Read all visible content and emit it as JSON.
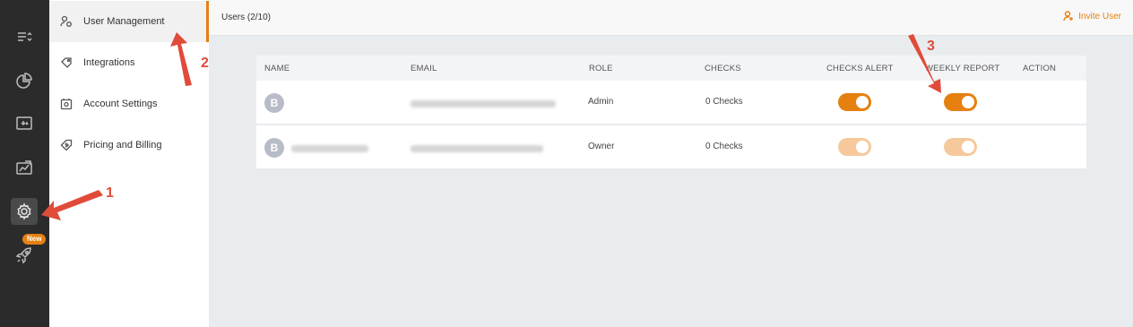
{
  "rail": {
    "items": [
      {
        "icon": "filter-list-icon"
      },
      {
        "icon": "pie-chart-icon"
      },
      {
        "icon": "monitor-icon"
      },
      {
        "icon": "analytics-icon"
      },
      {
        "icon": "gear-icon",
        "active": true
      },
      {
        "icon": "rocket-icon"
      }
    ],
    "new_badge": "New"
  },
  "subnav": {
    "items": [
      {
        "label": "User Management",
        "icon": "user-management-icon",
        "active": true
      },
      {
        "label": "Integrations",
        "icon": "integrations-icon"
      },
      {
        "label": "Account Settings",
        "icon": "account-settings-icon"
      },
      {
        "label": "Pricing and Billing",
        "icon": "pricing-billing-icon"
      }
    ]
  },
  "header": {
    "title": "Users (2/10)",
    "invite_label": "Invite User"
  },
  "table": {
    "columns": [
      "NAME",
      "EMAIL",
      "ROLE",
      "CHECKS",
      "CHECKS ALERT",
      "WEEKLY REPORT",
      "ACTION"
    ],
    "rows": [
      {
        "avatar": "B",
        "role": "Admin",
        "checks": "0 Checks",
        "checks_alert": true,
        "weekly_report": true
      },
      {
        "avatar": "B",
        "role": "Owner",
        "checks": "0 Checks",
        "checks_alert": true,
        "weekly_report": true
      }
    ]
  },
  "annotations": {
    "marker_1": "1",
    "marker_2": "2",
    "marker_3": "3",
    "color": "#e04b3a"
  },
  "colors": {
    "accent": "#e58012",
    "rail_bg": "#2b2b2b"
  }
}
